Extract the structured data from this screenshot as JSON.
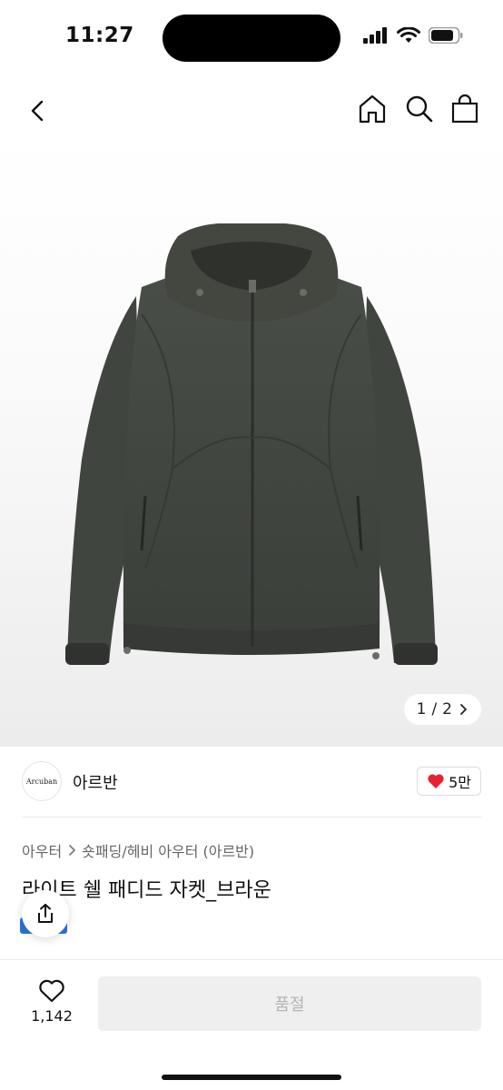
{
  "status_bar": {
    "time": "11:27"
  },
  "nav": {
    "back_icon": "chevron-left-icon",
    "home_icon": "home-icon",
    "search_icon": "search-icon",
    "bag_icon": "shopping-bag-icon"
  },
  "gallery": {
    "current": "1",
    "separator": "/",
    "total": "2"
  },
  "brand": {
    "logo_text": "Arcuban",
    "name": "아르반",
    "likes": "5만",
    "like_color": "#e8232f"
  },
  "breadcrumb": {
    "items": [
      "아우터",
      "숏패딩/헤비 아우터 (아르반)"
    ]
  },
  "product": {
    "title": "라이트 쉘 패디드 자켓_브라운"
  },
  "bottom_bar": {
    "wish_count": "1,142",
    "soldout_label": "품절"
  },
  "colors": {
    "accent_blue": "#2b74d8",
    "heart_red": "#e8232f",
    "disabled_bg": "#efefef"
  }
}
